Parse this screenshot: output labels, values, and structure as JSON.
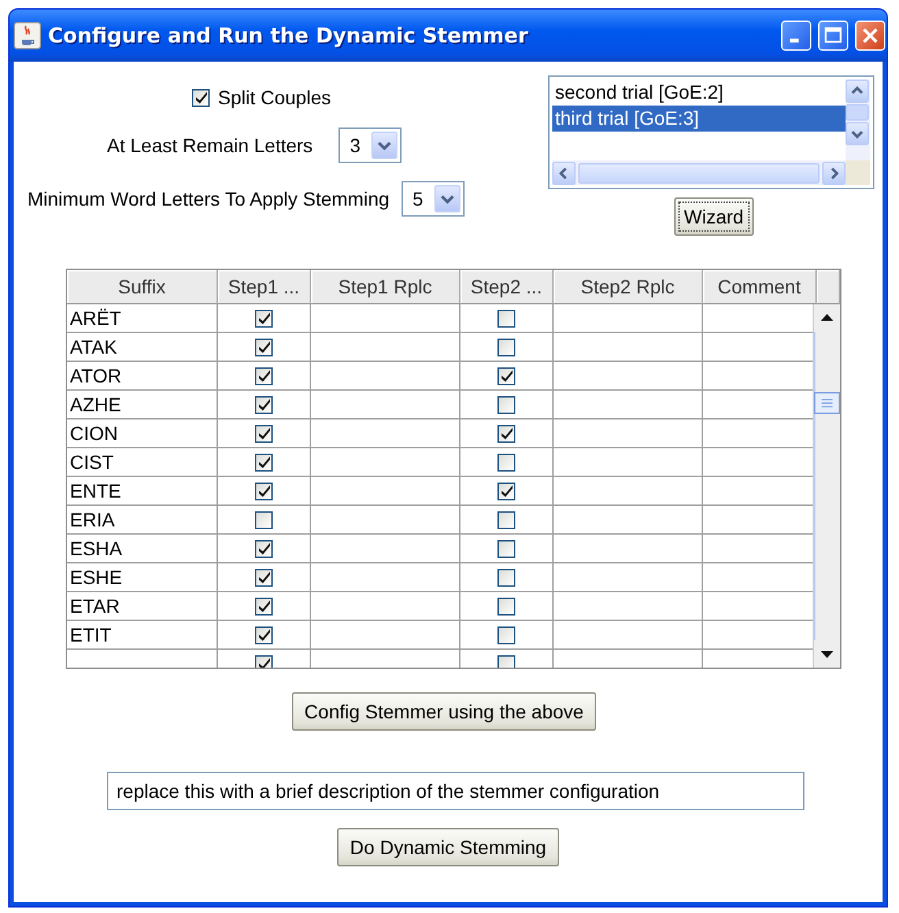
{
  "window": {
    "title": "Configure and Run the Dynamic Stemmer"
  },
  "split_couples": {
    "label": "Split Couples",
    "checked": true
  },
  "remain_letters": {
    "label": "At Least Remain Letters",
    "value": "3"
  },
  "min_word_letters": {
    "label": "Minimum Word Letters To Apply Stemming",
    "value": "5"
  },
  "trials": [
    {
      "label": "second trial [GoE:2]",
      "selected": false
    },
    {
      "label": "third trial [GoE:3]",
      "selected": true
    }
  ],
  "wizard_button": "Wizard",
  "table": {
    "columns": [
      "Suffix",
      "Step1 ...",
      "Step1 Rplc",
      "Step2 ...",
      "Step2 Rplc",
      "Comment"
    ],
    "rows": [
      {
        "suffix": "ARËT",
        "step1": true,
        "step2": false
      },
      {
        "suffix": "ATAK",
        "step1": true,
        "step2": false
      },
      {
        "suffix": "ATOR",
        "step1": true,
        "step2": true
      },
      {
        "suffix": "AZHE",
        "step1": true,
        "step2": false
      },
      {
        "suffix": "CION",
        "step1": true,
        "step2": true
      },
      {
        "suffix": "CIST",
        "step1": true,
        "step2": false
      },
      {
        "suffix": "ENTE",
        "step1": true,
        "step2": true
      },
      {
        "suffix": "ERIA",
        "step1": false,
        "step2": false
      },
      {
        "suffix": "ESHA",
        "step1": true,
        "step2": false
      },
      {
        "suffix": "ESHE",
        "step1": true,
        "step2": false
      },
      {
        "suffix": "ETAR",
        "step1": true,
        "step2": false
      },
      {
        "suffix": "ETIT",
        "step1": true,
        "step2": false
      },
      {
        "step1": true,
        "step2": false
      }
    ]
  },
  "config_button": "Config Stemmer using the above",
  "description": {
    "value": "replace this with a brief description of the stemmer configuration"
  },
  "run_button": "Do Dynamic Stemming"
}
